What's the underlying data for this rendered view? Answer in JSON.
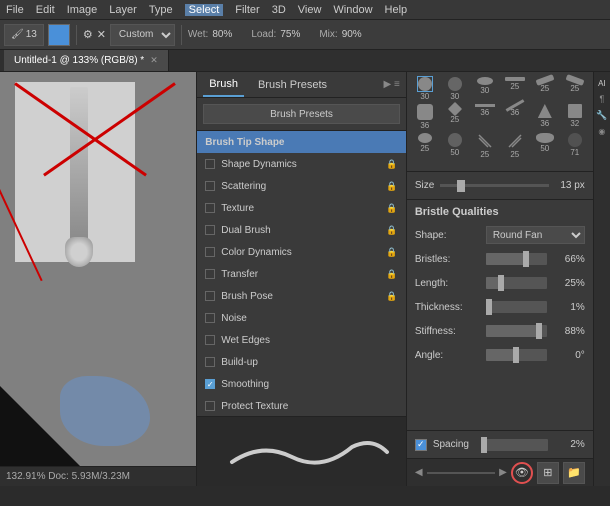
{
  "menubar": {
    "items": [
      "File",
      "Edit",
      "Image",
      "Layer",
      "Type",
      "Select",
      "Filter",
      "3D",
      "View",
      "Window",
      "Help"
    ]
  },
  "toolbar": {
    "preset_label": "Custom",
    "wet_label": "Wet:",
    "wet_value": "80%",
    "load_label": "Load:",
    "load_value": "75%",
    "mix_label": "Mix:",
    "mix_value": "90%",
    "size_num": "13"
  },
  "tab": {
    "title": "Untitled-1 @ 133% (RGB/8) *"
  },
  "brush_panel": {
    "tab1": "Brush",
    "tab2": "Brush Presets",
    "presets_btn": "Brush Presets",
    "options": [
      {
        "label": "Brush Tip Shape",
        "check": false,
        "lock": false,
        "selected": true
      },
      {
        "label": "Shape Dynamics",
        "check": false,
        "lock": true
      },
      {
        "label": "Scattering",
        "check": false,
        "lock": true
      },
      {
        "label": "Texture",
        "check": false,
        "lock": true
      },
      {
        "label": "Dual Brush",
        "check": false,
        "lock": true
      },
      {
        "label": "Color Dynamics",
        "check": false,
        "lock": true
      },
      {
        "label": "Transfer",
        "check": false,
        "lock": true
      },
      {
        "label": "Brush Pose",
        "check": false,
        "lock": true
      },
      {
        "label": "Noise",
        "check": false,
        "lock": false
      },
      {
        "label": "Wet Edges",
        "check": false,
        "lock": false
      },
      {
        "label": "Build-up",
        "check": false,
        "lock": false
      },
      {
        "label": "Smoothing",
        "check": true,
        "lock": false
      },
      {
        "label": "Protect Texture",
        "check": false,
        "lock": false
      }
    ]
  },
  "right_panel": {
    "size_label": "Size",
    "size_value": "13 px",
    "bristle_header": "Bristle Qualities",
    "shape_label": "Shape:",
    "shape_value": "Round Fan",
    "bristles_label": "Bristles:",
    "bristles_value": "66%",
    "bristles_pct": 66,
    "length_label": "Length:",
    "length_value": "25%",
    "length_pct": 25,
    "thickness_label": "Thickness:",
    "thickness_value": "1%",
    "thickness_pct": 1,
    "stiffness_label": "Stiffness:",
    "stiffness_value": "88%",
    "stiffness_pct": 88,
    "angle_label": "Angle:",
    "angle_value": "0°",
    "angle_pct": 50,
    "spacing_label": "Spacing",
    "spacing_value": "2%",
    "spacing_pct": 2
  },
  "status_bar": {
    "zoom": "132.91%",
    "doc_info": "Doc: 5.93M/3.23M"
  },
  "brush_tips": [
    [
      30,
      30,
      30,
      25,
      25,
      25
    ],
    [
      36,
      25,
      36,
      36,
      36,
      32
    ],
    [
      25,
      50,
      25,
      25,
      50,
      71
    ]
  ]
}
